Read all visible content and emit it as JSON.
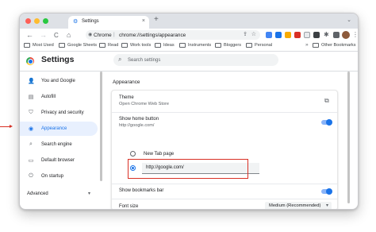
{
  "browser": {
    "tab_title": "Settings",
    "tab_close": "×",
    "new_tab": "+",
    "tab_menu": "⌄",
    "back": "←",
    "forward": "→",
    "reload": "C",
    "home": "⌂",
    "omnibox_site": "Chrome",
    "omnibox_sep": "|",
    "omnibox_url": "chrome://settings/appearance",
    "menu": "⋮",
    "colors": {
      "accent": "#1a73e8",
      "highlight": "#d93025"
    }
  },
  "bookmarks": {
    "items": [
      "Most Used",
      "Google Sheets",
      "Read",
      "Work tools",
      "Ideas",
      "Instruments",
      "Bloggers",
      "Personal"
    ],
    "more": "»",
    "other": "Other Bookmarks"
  },
  "header": {
    "title": "Settings",
    "search_placeholder": "Search settings"
  },
  "sidebar": {
    "items": [
      {
        "label": "You and Google",
        "icon": "person-icon",
        "glyph": "👤"
      },
      {
        "label": "Autofill",
        "icon": "autofill-icon",
        "glyph": "▤"
      },
      {
        "label": "Privacy and security",
        "icon": "shield-icon",
        "glyph": "⛉"
      },
      {
        "label": "Appearance",
        "icon": "palette-icon",
        "glyph": "◉"
      },
      {
        "label": "Search engine",
        "icon": "search-icon",
        "glyph": "⌕"
      },
      {
        "label": "Default browser",
        "icon": "browser-icon",
        "glyph": "▭"
      },
      {
        "label": "On startup",
        "icon": "power-icon",
        "glyph": "⏻"
      }
    ],
    "active": "Appearance",
    "advanced": "Advanced",
    "advanced_chevron": "▾"
  },
  "main": {
    "section_title": "Appearance",
    "theme_title": "Theme",
    "theme_sub": "Open Chrome Web Store",
    "theme_action": "⧉",
    "home_title": "Show home button",
    "home_sub": "http://google.com/",
    "home_toggle": true,
    "radio_new_tab": "New Tab page",
    "custom_url": "http://google.com/",
    "selected_option": "custom",
    "bookmarks_bar_title": "Show bookmarks bar",
    "bookmarks_bar_toggle": true,
    "font_size_title": "Font size",
    "font_size_value": "Medium (Recommended)",
    "font_size_chevron": "▾"
  }
}
